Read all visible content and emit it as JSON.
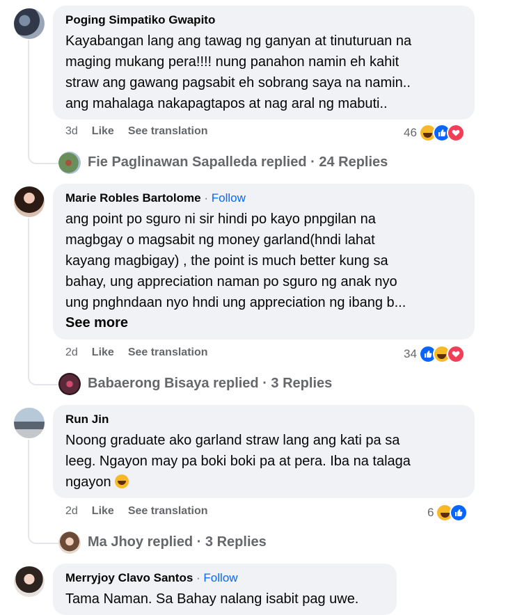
{
  "comments": [
    {
      "author": "Poging Simpatiko Gwapito",
      "lines": [
        "Kayabangan lang ang tawag ng ganyan at tinuturuan na",
        "maging mukang pera!!!! nung panahon namin eh kahit",
        "straw ang gawang pagsabit eh sobrang saya na namin..",
        "ang mahalaga nakapagtapos at nag aral ng mabuti.."
      ],
      "time": "3d",
      "like_label": "Like",
      "translate_label": "See translation",
      "reaction_count": "46",
      "reaction_icons": [
        "haha-icon",
        "like-icon",
        "love-icon"
      ],
      "replies_text": "Fie Paglinawan Sapalleda replied · 24 Replies"
    },
    {
      "author": "Marie Robles Bartolome",
      "dot": "·",
      "follow_label": "Follow",
      "lines": [
        "ang point po sguro ni sir hindi po kayo pnpgilan na",
        "magbgay o magsabit ng money garland(hndi lahat",
        "kayang magbigay) , the point is much better kung sa",
        "bahay, ung appreciation naman po sguro ng anak nyo",
        "ung pnghndaan nyo hndi ung appreciation ng ibang b..."
      ],
      "see_more": "See more",
      "time": "2d",
      "like_label": "Like",
      "translate_label": "See translation",
      "reaction_count": "34",
      "reaction_icons": [
        "like-icon",
        "haha-icon",
        "love-icon"
      ],
      "replies_text": "Babaerong Bisaya replied · 3 Replies"
    },
    {
      "author": "Run Jin",
      "lines": [
        "Noong graduate ako garland straw lang ang kati pa sa",
        "leeg. Ngayon may pa boki boki pa at pera. Iba na talaga",
        "ngayon"
      ],
      "time": "2d",
      "like_label": "Like",
      "translate_label": "See translation",
      "reaction_count": "6",
      "reaction_icons": [
        "haha-icon",
        "like-icon"
      ],
      "replies_text": "Ma Jhoy replied · 3 Replies"
    },
    {
      "author": "Merryjoy Clavo Santos",
      "dot": "·",
      "follow_label": "Follow",
      "lines": [
        "Tama Naman. Sa Bahay nalang isabit pag uwe."
      ]
    }
  ],
  "colors": {
    "bubble": "#f0f2f5",
    "link": "#0866ff",
    "muted": "#65676b"
  }
}
